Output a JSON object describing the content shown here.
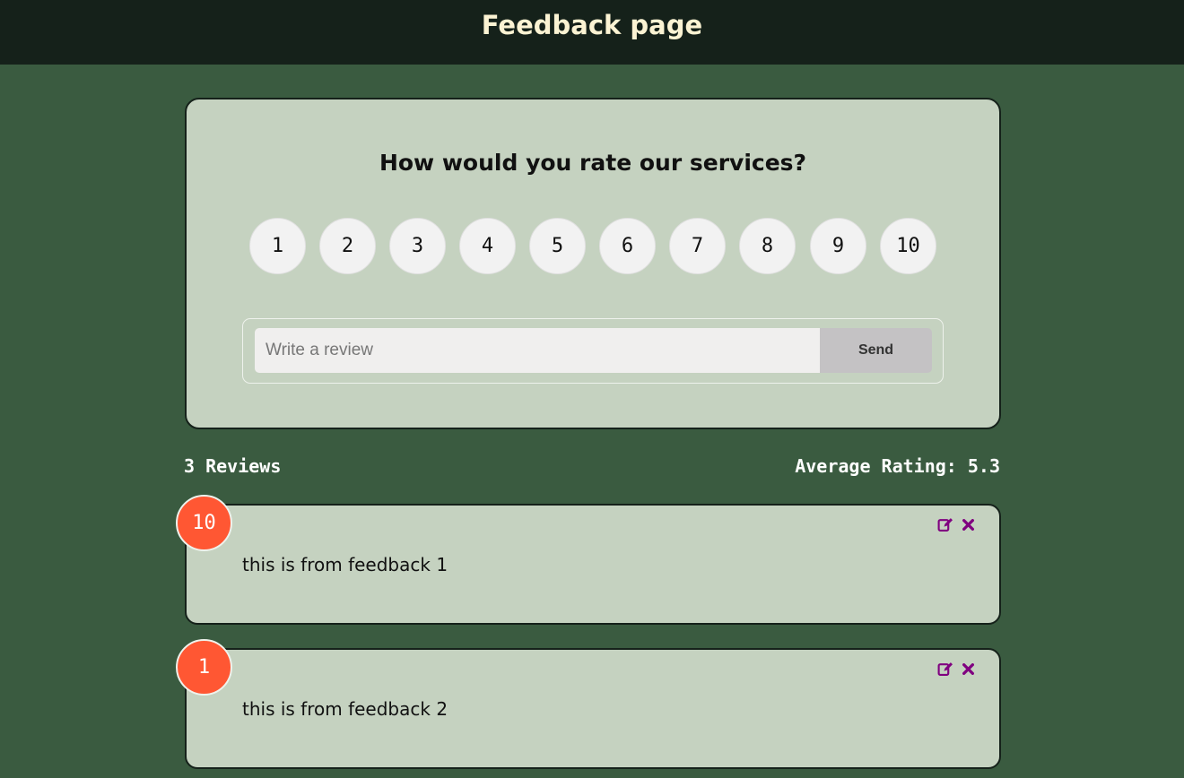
{
  "header": {
    "title": "Feedback page"
  },
  "form": {
    "question": "How would you rate our services?",
    "ratings": [
      "1",
      "2",
      "3",
      "4",
      "5",
      "6",
      "7",
      "8",
      "9",
      "10"
    ],
    "review_placeholder": "Write a review",
    "send_label": "Send"
  },
  "stats": {
    "reviews_count": "3 Reviews",
    "average_rating": "Average Rating: 5.3"
  },
  "feedback": [
    {
      "rating": "10",
      "text": "this is from feedback 1"
    },
    {
      "rating": "1",
      "text": "this is from feedback 2"
    }
  ],
  "icons": {
    "edit": "edit-icon",
    "delete": "close-icon"
  },
  "colors": {
    "background": "#3a5b40",
    "header": "#15211a",
    "card": "#c5d2c0",
    "badge": "#ff5733",
    "icon": "#800080"
  }
}
